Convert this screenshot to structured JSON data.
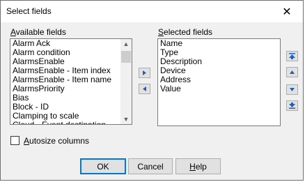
{
  "window": {
    "title": "Select fields",
    "close_icon": "close-icon"
  },
  "available": {
    "label_underlined": "A",
    "label_rest": "vailable fields",
    "items": [
      "Alarm Ack",
      "Alarm condition",
      "AlarmsEnable",
      "AlarmsEnable - Item index",
      "AlarmsEnable - Item name",
      "AlarmsPriority",
      "Bias",
      "Block - ID",
      "Clamping to scale",
      "Cloud - Event destination"
    ]
  },
  "selected": {
    "label_underlined": "S",
    "label_rest": "elected fields",
    "items": [
      "Name",
      "Type",
      "Description",
      "Device",
      "Address",
      "Value"
    ]
  },
  "transfer": {
    "add_icon": "arrow-right-icon",
    "remove_icon": "arrow-left-icon"
  },
  "order": {
    "top_icon": "move-top-icon",
    "up_icon": "move-up-icon",
    "down_icon": "move-down-icon",
    "bottom_icon": "move-bottom-icon"
  },
  "autosize": {
    "label_underlined": "A",
    "label_rest": "utosize columns",
    "checked": false
  },
  "buttons": {
    "ok": "OK",
    "cancel": "Cancel",
    "help_underlined": "H",
    "help_rest": "elp"
  },
  "colors": {
    "accent": "#0078d7",
    "arrow_blue": "#1e5fbf"
  }
}
